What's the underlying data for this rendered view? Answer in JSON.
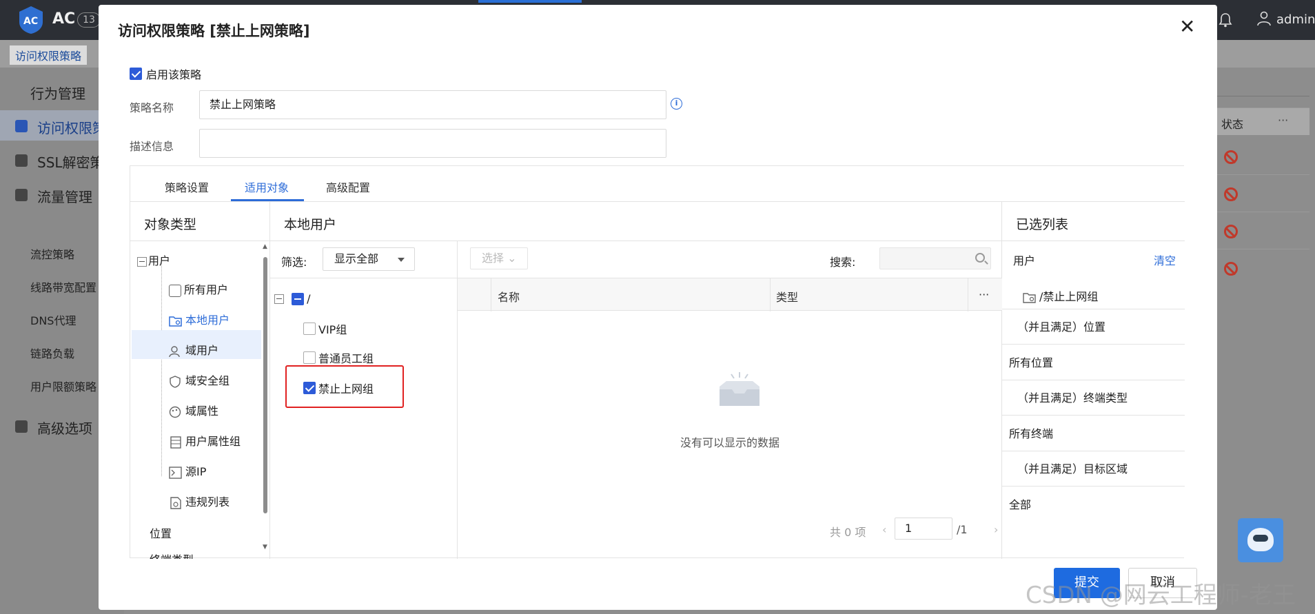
{
  "app": {
    "logo_text": "AC",
    "version_badge": "13",
    "user": "admin"
  },
  "breadcrumb": {
    "label": "访问权限策略"
  },
  "sidebar": {
    "items": [
      {
        "label": "行为管理"
      },
      {
        "label": "访问权限策"
      },
      {
        "label": "SSL解密策"
      },
      {
        "label": "流量管理"
      },
      {
        "label": "流控策略"
      },
      {
        "label": "线路带宽配置"
      },
      {
        "label": "DNS代理"
      },
      {
        "label": "链路负载"
      },
      {
        "label": "用户限额策略"
      },
      {
        "label": "高级选项"
      }
    ]
  },
  "bg_table": {
    "status_header": "状态",
    "more": "···"
  },
  "dialog": {
    "title": "访问权限策略 [禁止上网策略]",
    "close": "✕",
    "enable_label": "启用该策略",
    "name_label": "策略名称",
    "name_value": "禁止上网策略",
    "desc_label": "描述信息",
    "desc_value": "",
    "tabs": [
      {
        "label": "策略设置"
      },
      {
        "label": "适用对象"
      },
      {
        "label": "高级配置"
      }
    ],
    "object_type": {
      "header": "对象类型",
      "root": "用户",
      "children": [
        {
          "label": "所有用户",
          "icon": "checkbox-icon"
        },
        {
          "label": "本地用户",
          "icon": "folder-user-icon"
        },
        {
          "label": "域用户",
          "icon": "users-icon"
        },
        {
          "label": "域安全组",
          "icon": "shield-icon"
        },
        {
          "label": "域属性",
          "icon": "palette-icon"
        },
        {
          "label": "用户属性组",
          "icon": "stack-icon"
        },
        {
          "label": "源IP",
          "icon": "terminal-icon"
        },
        {
          "label": "违规列表",
          "icon": "doc-icon"
        }
      ],
      "more": [
        {
          "label": "位置"
        },
        {
          "label": "终端类型"
        }
      ]
    },
    "local_users": {
      "header": "本地用户",
      "filter_label": "筛选:",
      "filter_value": "显示全部",
      "root": "/",
      "groups": [
        {
          "label": "VIP组",
          "checked": false
        },
        {
          "label": "普通员工组",
          "checked": false
        },
        {
          "label": "禁止上网组",
          "checked": true
        }
      ],
      "select_btn": "选择",
      "search_label": "搜索:",
      "search_placeholder": "",
      "col_name": "名称",
      "col_type": "类型",
      "col_more": "···",
      "empty_text": "没有可以显示的数据",
      "pager": {
        "total": "共 0 项",
        "page": "1",
        "of": "/1",
        "prev": "‹",
        "next": "›"
      }
    },
    "selected": {
      "header": "已选列表",
      "user_label": "用户",
      "clear": "清空",
      "entry": "/禁止上网组",
      "conditions": [
        {
          "title": "（并且满足）位置",
          "value": "所有位置"
        },
        {
          "title": "（并且满足）终端类型",
          "value": "所有终端"
        },
        {
          "title": "（并且满足）目标区域",
          "value": "全部"
        }
      ]
    },
    "submit": "提交",
    "cancel": "取消"
  },
  "watermark": "CSDN @网云工程师-老王"
}
